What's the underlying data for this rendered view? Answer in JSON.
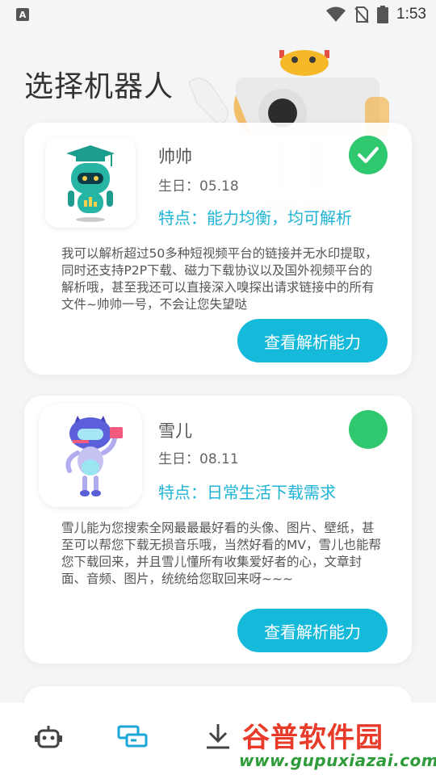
{
  "status_bar": {
    "left_icon_letter": "A",
    "time": "1:53",
    "icons": [
      "a-notification-icon",
      "wifi-icon",
      "no-sim-icon",
      "battery-icon"
    ]
  },
  "page_title": "选择机器人",
  "bots": [
    {
      "name": "帅帅",
      "birthday": "生日：05.18",
      "feature": "特点：能力均衡，均可解析",
      "description": "我可以解析超过50多种短视频平台的链接并无水印提取，同时还支持P2P下载、磁力下载协议以及国外视频平台的解析哦，甚至我还可以直接深入嗅探出请求链接中的所有文件~帅帅一号，不会让您失望哒",
      "button_label": "查看解析能力",
      "selected": true
    },
    {
      "name": "雪儿",
      "birthday": "生日：08.11",
      "feature": "特点：日常生活下载需求",
      "description": "雪儿能为您搜索全网最最最好看的头像、图片、壁纸，甚至可以帮您下载无损音乐哦，当然好看的MV，雪儿也能帮您下载回来，并且雪儿懂所有收集爱好者的心，文章封面、音频、图片，统统给您取回来呀~~~",
      "button_label": "查看解析能力",
      "selected": false
    }
  ],
  "bottom_nav": {
    "items": [
      "robot-icon",
      "parse-icon",
      "download-icon"
    ],
    "active_index": 1
  },
  "watermark": {
    "title": "谷普软件园",
    "url": "www.gupuxiazai.com"
  },
  "colors": {
    "accent": "#15b9d9",
    "feature_text": "#1fb4d6",
    "selected_check": "#2fc86e",
    "background": "#f4f5f7"
  }
}
